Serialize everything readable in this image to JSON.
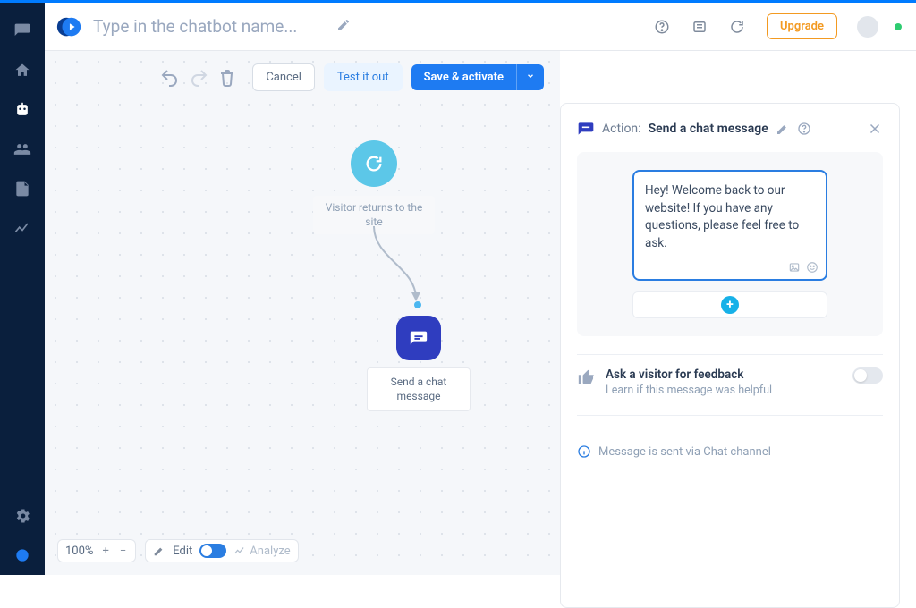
{
  "header": {
    "title_placeholder": "Type in the chatbot name...",
    "upgrade_label": "Upgrade"
  },
  "toolbar": {
    "cancel_label": "Cancel",
    "test_label": "Test it out",
    "save_label": "Save & activate"
  },
  "flow": {
    "start_label": "Visitor returns to the site",
    "action_label": "Send a chat message"
  },
  "bottom": {
    "zoom": "100%",
    "edit_label": "Edit",
    "analyze_label": "Analyze"
  },
  "panel": {
    "prefix": "Action:",
    "title": "Send a chat message",
    "message_text": "Hey! Welcome back to our website! If you have any questions, please feel free to ask.",
    "feedback_title": "Ask a visitor for feedback",
    "feedback_sub": "Learn if this message was helpful",
    "info_text": "Message is sent via Chat channel"
  }
}
